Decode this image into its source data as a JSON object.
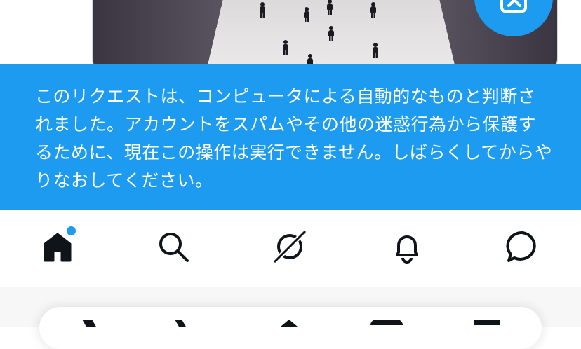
{
  "media": {
    "image_subject": "people walking on a walkway"
  },
  "fab": {
    "icon": "compose-media-icon",
    "color": "#1d9bf0"
  },
  "toast": {
    "message": "このリクエストは、コンピュータによる自動的なものと判断されました。アカウントをスパムやその他の迷惑行為から保護するために、現在この操作は実行できません。しばらくしてからやりなおしてください。",
    "background": "#1d9bf0"
  },
  "tabbar": {
    "tabs": [
      {
        "name": "home",
        "icon": "home-icon",
        "active": true,
        "has_badge": true
      },
      {
        "name": "search",
        "icon": "search-icon",
        "active": false
      },
      {
        "name": "grok",
        "icon": "grok-icon",
        "active": false
      },
      {
        "name": "notifications",
        "icon": "bell-icon",
        "active": false
      },
      {
        "name": "messages",
        "icon": "message-icon",
        "active": false
      }
    ],
    "badge_color": "#1d9bf0"
  }
}
